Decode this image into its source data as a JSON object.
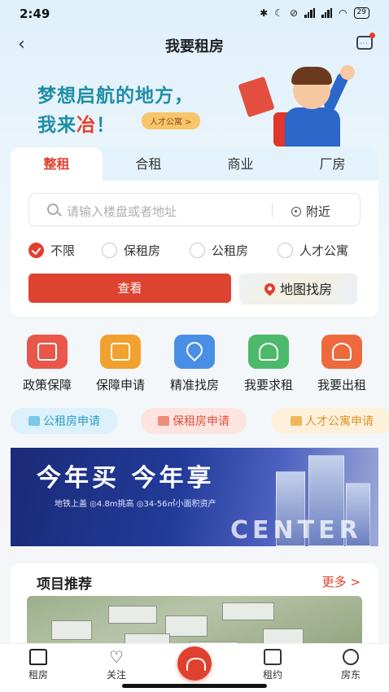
{
  "status": {
    "time": "2:49",
    "battery": "29"
  },
  "nav": {
    "title": "我要租房"
  },
  "hero": {
    "line1": "梦想启航的地方，",
    "line2_pre": "我来",
    "line2_hl": "冶",
    "line2_post": "！",
    "tag": "人才公寓 >"
  },
  "tabs": [
    "整租",
    "合租",
    "商业",
    "厂房"
  ],
  "search": {
    "placeholder": "请输入楼盘或者地址",
    "nearby": "附近"
  },
  "radios": [
    {
      "label": "不限",
      "checked": true
    },
    {
      "label": "保租房",
      "checked": false
    },
    {
      "label": "公租房",
      "checked": false
    },
    {
      "label": "人才公寓",
      "checked": false
    }
  ],
  "buttons": {
    "query": "查看",
    "map": "地图找房"
  },
  "services": [
    {
      "label": "政策保障",
      "icon": "policy-icon",
      "color": "#e9564a"
    },
    {
      "label": "保障申请",
      "icon": "application-icon",
      "color": "#f0a12e"
    },
    {
      "label": "精准找房",
      "icon": "location-icon",
      "color": "#4a8fe6"
    },
    {
      "label": "我要求租",
      "icon": "person-icon",
      "color": "#4cba6a"
    },
    {
      "label": "我要出租",
      "icon": "key-icon",
      "color": "#ee6a3e"
    }
  ],
  "pills": [
    {
      "label": "公租房申请",
      "bg": "#dcf1fb",
      "fg": "#2a9cc7"
    },
    {
      "label": "保租房申请",
      "bg": "#fde4e0",
      "fg": "#e2503c"
    },
    {
      "label": "人才公寓申请",
      "bg": "#fdf1dc",
      "fg": "#e0932c"
    }
  ],
  "banner": {
    "title": "今年买 今年享",
    "subtitle": "地铁上盖 ◎4.8m挑高 ◎34-56㎡小面积资产",
    "english": "CENTER"
  },
  "recommend": {
    "title": "项目推荐",
    "more": "更多 >"
  },
  "tabbar": [
    "租房",
    "关注",
    "租约",
    "房东"
  ]
}
